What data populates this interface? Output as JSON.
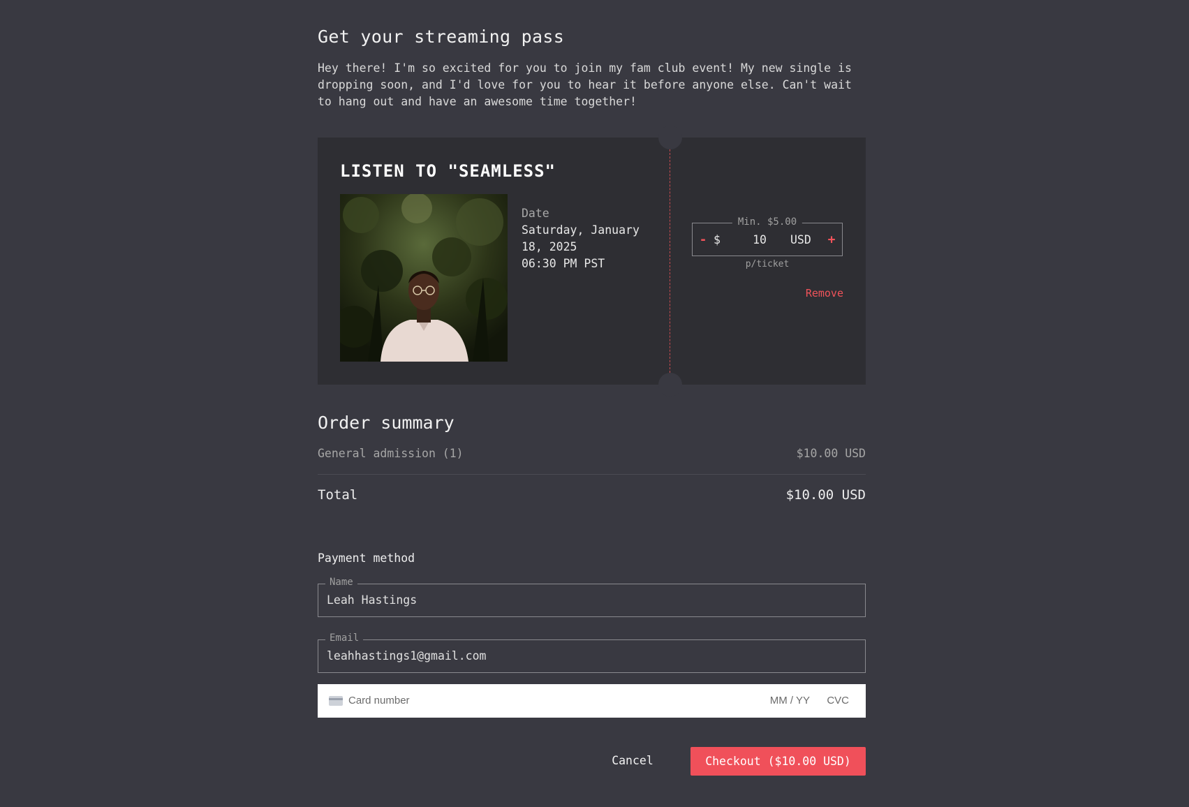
{
  "page": {
    "title": "Get your streaming pass",
    "intro": "Hey there! I'm so excited for you to join my fam club event! My new single is dropping soon, and I'd love for you to hear it before anyone else. Can't wait to hang out and have an awesome time together!"
  },
  "ticket": {
    "title": "LISTEN TO \"SEAMLESS\"",
    "photo_desc": "portrait-photo",
    "date_label": "Date",
    "date_value": "Saturday, January 18, 2025",
    "time_value": "06:30 PM PST",
    "price": {
      "min_label": "Min. $5.00",
      "decrement": "-",
      "currency_symbol": "$",
      "amount": "10",
      "currency_code": "USD",
      "increment": "+",
      "per_ticket": "p/ticket"
    },
    "remove_label": "Remove"
  },
  "summary": {
    "title": "Order summary",
    "line_label": "General admission (1)",
    "line_value": "$10.00 USD",
    "total_label": "Total",
    "total_value": "$10.00 USD"
  },
  "payment": {
    "title": "Payment method",
    "name_label": "Name",
    "name_value": "Leah Hastings",
    "email_label": "Email",
    "email_value": "leahhastings1@gmail.com",
    "card_placeholder": "Card number",
    "exp_placeholder": "MM / YY",
    "cvc_placeholder": "CVC"
  },
  "actions": {
    "cancel_label": "Cancel",
    "checkout_label": "Checkout ($10.00 USD)"
  },
  "colors": {
    "background": "#393941",
    "card": "#2e2e33",
    "accent": "#f0505a"
  }
}
